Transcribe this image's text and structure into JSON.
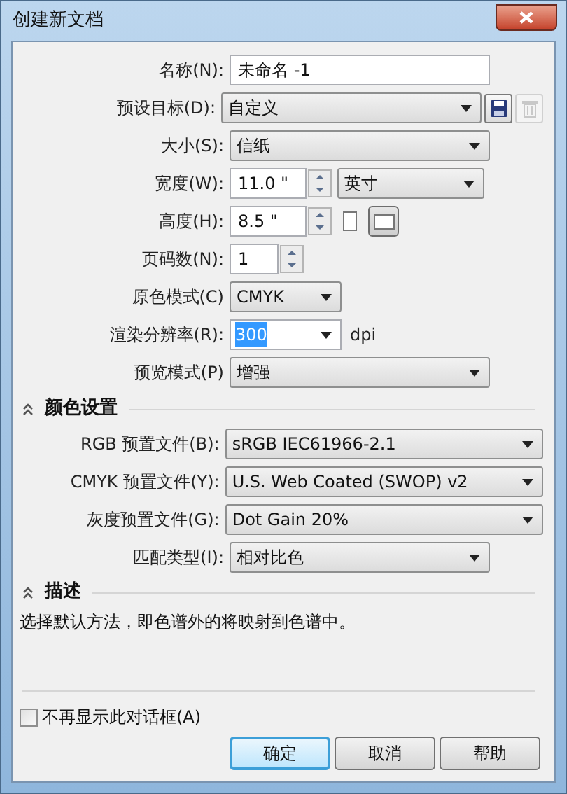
{
  "window": {
    "title": "创建新文档"
  },
  "fields": [
    {
      "kind": "text",
      "label": "名称(N):",
      "value": "未命名 -1"
    },
    {
      "kind": "select_actions",
      "label": "预设目标(D):",
      "value": "自定义",
      "actions": [
        {
          "kind": "save",
          "disabled": false
        },
        {
          "kind": "delete",
          "disabled": true
        }
      ]
    },
    {
      "kind": "select",
      "label": "大小(S):",
      "value": "信纸"
    },
    {
      "kind": "spin_unit",
      "label": "宽度(W):",
      "value": "11.0 \"",
      "unit": "英寸"
    },
    {
      "kind": "spin_orientation",
      "label": "高度(H):",
      "value": "8.5 \"",
      "orientations": [
        {
          "kind": "portrait",
          "selected": false
        },
        {
          "kind": "landscape",
          "selected": true
        }
      ]
    },
    {
      "kind": "spin",
      "label": "页码数(N):",
      "value": "1"
    },
    {
      "kind": "short_select",
      "label": "原色模式(C)",
      "value": "CMYK"
    },
    {
      "kind": "combo",
      "label": "渲染分辨率(R):",
      "value": "300",
      "value_selected": true,
      "suffix": "dpi"
    },
    {
      "kind": "select",
      "label": "预览模式(P)",
      "value": "增强"
    }
  ],
  "color_settings": {
    "title": "颜色设置",
    "expanded": true,
    "fields": [
      {
        "label": "RGB 预置文件(B):",
        "value": "sRGB IEC61966-2.1"
      },
      {
        "label": "CMYK 预置文件(Y):",
        "value": "U.S. Web Coated (SWOP) v2"
      },
      {
        "label": "灰度预置文件(G):",
        "value": "Dot Gain 20%"
      },
      {
        "label": "匹配类型(I):",
        "value": "相对比色",
        "short": true
      }
    ]
  },
  "description": {
    "title": "描述",
    "expanded": true,
    "text": "选择默认方法，即色谱外的将映射到色谱中。"
  },
  "dont_show_again": {
    "label": "不再显示此对话框(A)",
    "checked": false
  },
  "buttons": [
    {
      "label": "确定",
      "default": true
    },
    {
      "label": "取消",
      "default": false
    },
    {
      "label": "帮助",
      "default": false
    }
  ]
}
